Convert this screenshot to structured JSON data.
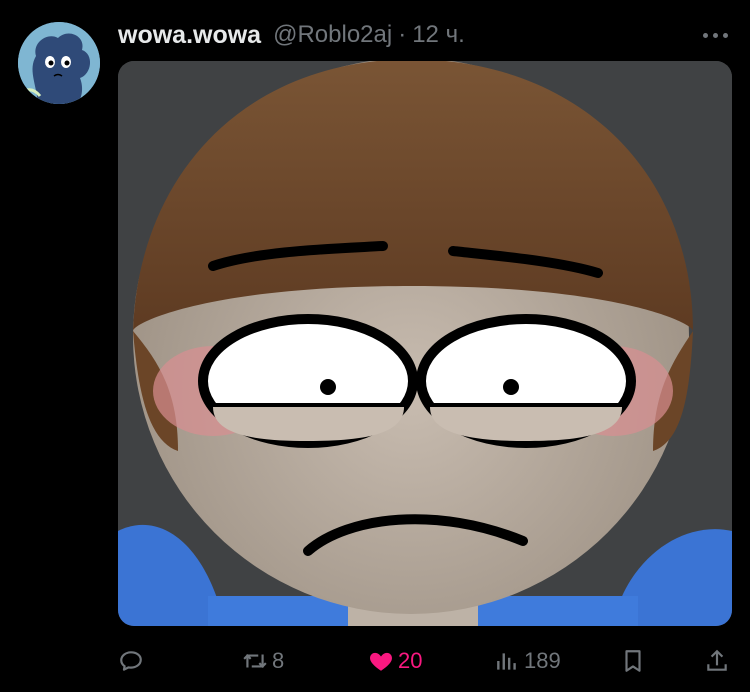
{
  "tweet": {
    "author": {
      "display_name": "wowa.wowa",
      "handle": "@Roblo2aj"
    },
    "separator": "·",
    "time": "12 ч.",
    "more_icon": "more-horizontal-icon"
  },
  "actions": {
    "reply": {
      "icon": "reply-icon",
      "count": ""
    },
    "retweet": {
      "icon": "retweet-icon",
      "count": "8"
    },
    "like": {
      "icon": "heart-icon",
      "count": "20",
      "active": true,
      "color": "#f91880"
    },
    "views": {
      "icon": "views-chart-icon",
      "count": "189"
    },
    "bookmark": {
      "icon": "bookmark-icon"
    },
    "share": {
      "icon": "share-icon"
    }
  },
  "colors": {
    "background": "#000000",
    "primary_text": "#e7e9ea",
    "secondary_text": "#71767b",
    "like_active": "#f91880"
  }
}
